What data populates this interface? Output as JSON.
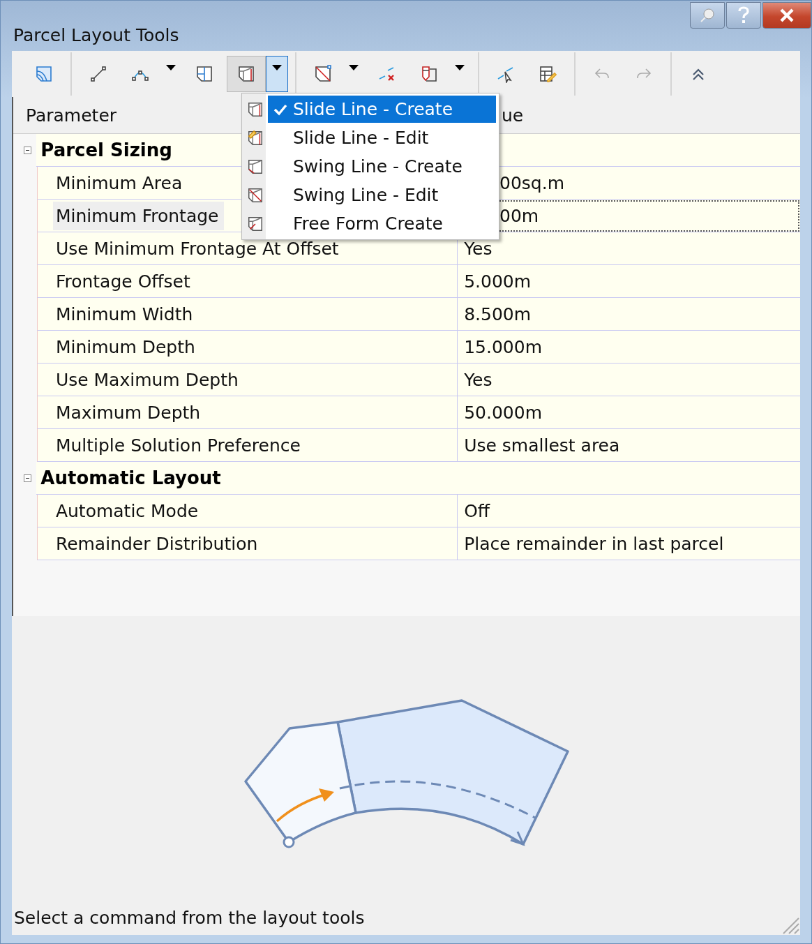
{
  "window": {
    "title": "Parcel Layout Tools"
  },
  "toolbar": {
    "groups": [
      {
        "buttons": [
          {
            "kind": "button",
            "pressed": false,
            "disabled": false
          }
        ]
      },
      {
        "buttons": [
          {
            "kind": "button",
            "pressed": false,
            "disabled": false
          },
          {
            "kind": "split",
            "pressed": false,
            "disabled": false,
            "open": false
          },
          {
            "kind": "button",
            "pressed": false,
            "disabled": false
          },
          {
            "kind": "split",
            "pressed": true,
            "disabled": false,
            "open": true
          }
        ]
      },
      {
        "buttons": [
          {
            "kind": "split",
            "pressed": false,
            "disabled": false,
            "open": false
          },
          {
            "kind": "button",
            "pressed": false,
            "disabled": false
          },
          {
            "kind": "split",
            "pressed": false,
            "disabled": false,
            "open": false
          }
        ]
      },
      {
        "buttons": [
          {
            "kind": "button",
            "pressed": false,
            "disabled": false
          },
          {
            "kind": "button",
            "pressed": false,
            "disabled": false
          }
        ]
      },
      {
        "buttons": [
          {
            "kind": "button",
            "pressed": false,
            "disabled": true
          },
          {
            "kind": "button",
            "pressed": false,
            "disabled": true
          }
        ]
      },
      {
        "buttons": [
          {
            "kind": "button",
            "pressed": false,
            "disabled": false
          }
        ]
      }
    ]
  },
  "menu": {
    "items": [
      {
        "label": "Slide Line - Create",
        "selected": true,
        "checked": true
      },
      {
        "label": "Slide Line - Edit",
        "selected": false,
        "checked": false
      },
      {
        "label": "Swing Line - Create",
        "selected": false,
        "checked": false
      },
      {
        "label": "Swing Line - Edit",
        "selected": false,
        "checked": false
      },
      {
        "label": "Free Form Create",
        "selected": false,
        "checked": false
      }
    ]
  },
  "grid": {
    "columns": [
      {
        "label": "Parameter"
      },
      {
        "label": "ue",
        "partly_hidden": true
      }
    ],
    "sections": [
      {
        "title": "Parcel Sizing",
        "expanded": true,
        "rows": [
          {
            "name": "Minimum Area",
            "value": "00sq.m",
            "partly_hidden": true,
            "selected": false
          },
          {
            "name": "Minimum Frontage",
            "value": "00m",
            "partly_hidden": true,
            "selected": true
          },
          {
            "name": "Use Minimum Frontage At Offset",
            "value": "Yes",
            "partly_hidden": false,
            "selected": false
          },
          {
            "name": "Frontage Offset",
            "value": "5.000m",
            "partly_hidden": false,
            "selected": false
          },
          {
            "name": "Minimum Width",
            "value": "8.500m",
            "partly_hidden": false,
            "selected": false
          },
          {
            "name": "Minimum Depth",
            "value": "15.000m",
            "partly_hidden": false,
            "selected": false
          },
          {
            "name": "Use Maximum Depth",
            "value": "Yes",
            "partly_hidden": false,
            "selected": false
          },
          {
            "name": "Maximum Depth",
            "value": "50.000m",
            "partly_hidden": false,
            "selected": false
          },
          {
            "name": "Multiple Solution Preference",
            "value": "Use smallest area",
            "partly_hidden": false,
            "selected": false
          }
        ]
      },
      {
        "title": "Automatic Layout",
        "expanded": true,
        "rows": [
          {
            "name": "Automatic Mode",
            "value": "Off",
            "partly_hidden": false,
            "selected": false
          },
          {
            "name": "Remainder Distribution",
            "value": "Place remainder in last parcel",
            "partly_hidden": false,
            "selected": false
          }
        ]
      }
    ]
  },
  "status_bar": {
    "text": "Select a command from the layout tools"
  }
}
